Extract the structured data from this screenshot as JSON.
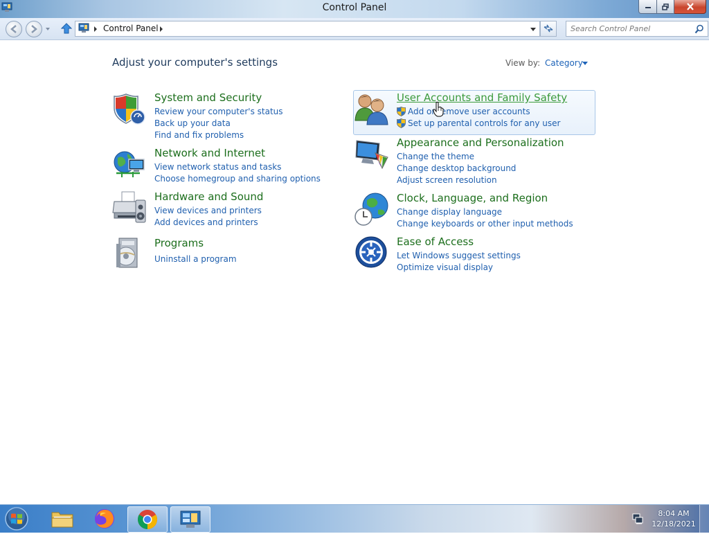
{
  "window": {
    "title": "Control Panel"
  },
  "address_bar": {
    "crumb": "Control Panel"
  },
  "search": {
    "placeholder": "Search Control Panel"
  },
  "main": {
    "heading": "Adjust your computer's settings",
    "view_by_label": "View by:",
    "view_by_value": "Category"
  },
  "categories": [
    {
      "title": "System and Security",
      "icon": "shield-icon",
      "links": [
        "Review your computer's status",
        "Back up your data",
        "Find and fix problems"
      ]
    },
    {
      "title": "Network and Internet",
      "icon": "network-globe-icon",
      "links": [
        "View network status and tasks",
        "Choose homegroup and sharing options"
      ]
    },
    {
      "title": "Hardware and Sound",
      "icon": "printer-speaker-icon",
      "links": [
        "View devices and printers",
        "Add devices and printers"
      ]
    },
    {
      "title": "Programs",
      "icon": "programs-icon",
      "links": [
        "Uninstall a program"
      ]
    },
    {
      "title": "User Accounts and Family Safety",
      "icon": "users-icon",
      "links": [
        "Add or remove user accounts",
        "Set up parental controls for any user"
      ]
    },
    {
      "title": "Appearance and Personalization",
      "icon": "monitor-palette-icon",
      "links": [
        "Change the theme",
        "Change desktop background",
        "Adjust screen resolution"
      ]
    },
    {
      "title": "Clock, Language, and Region",
      "icon": "clock-globe-icon",
      "links": [
        "Change display language",
        "Change keyboards or other input methods"
      ]
    },
    {
      "title": "Ease of Access",
      "icon": "ease-of-access-icon",
      "links": [
        "Let Windows suggest settings",
        "Optimize visual display"
      ]
    }
  ],
  "taskbar": {
    "items": [
      "file-explorer-icon",
      "firefox-icon",
      "chrome-icon",
      "control-panel-icon"
    ],
    "time": "8:04 AM",
    "date": "12/18/2021"
  },
  "colors": {
    "category_title": "#1c6e1c",
    "link": "#1f5fae",
    "hover_title": "#3b9a3b"
  }
}
